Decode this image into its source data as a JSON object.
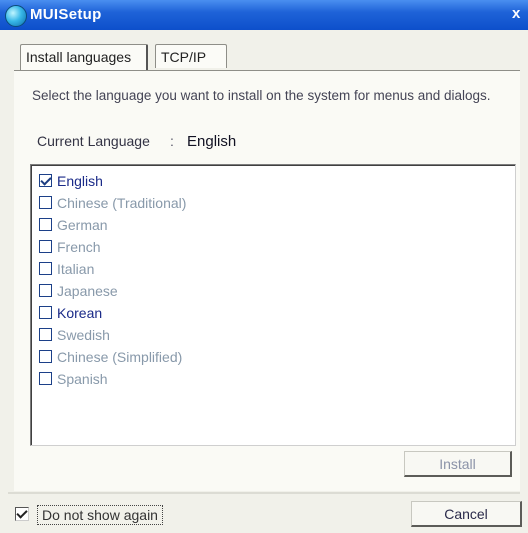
{
  "window": {
    "title": "MUISetup",
    "close_glyph": "x",
    "icon": "globe-icon"
  },
  "tabs": [
    {
      "label": "Install languages",
      "active": true
    },
    {
      "label": "TCP/IP",
      "active": false
    }
  ],
  "content": {
    "description": "Select the language you want to install on the system for menus and dialogs.",
    "current_language_label": "Current Language",
    "current_language_separator": ":",
    "current_language_value": "English"
  },
  "languages": [
    {
      "label": "English",
      "checked": true,
      "style": "bright"
    },
    {
      "label": "Chinese (Traditional)",
      "checked": false,
      "style": "dim"
    },
    {
      "label": "German",
      "checked": false,
      "style": "dim"
    },
    {
      "label": "French",
      "checked": false,
      "style": "dim"
    },
    {
      "label": "Italian",
      "checked": false,
      "style": "dim"
    },
    {
      "label": "Japanese",
      "checked": false,
      "style": "dim"
    },
    {
      "label": "Korean",
      "checked": false,
      "style": "bright"
    },
    {
      "label": "Swedish",
      "checked": false,
      "style": "dim"
    },
    {
      "label": "Chinese (Simplified)",
      "checked": false,
      "style": "dim"
    },
    {
      "label": "Spanish",
      "checked": false,
      "style": "dim"
    }
  ],
  "buttons": {
    "install_label": "Install",
    "cancel_label": "Cancel"
  },
  "footer": {
    "do_not_show_label": "Do not show again",
    "do_not_show_checked": true
  },
  "colors": {
    "titlebar": "#0d4fcb",
    "checkbox_border": "#1c4088"
  }
}
